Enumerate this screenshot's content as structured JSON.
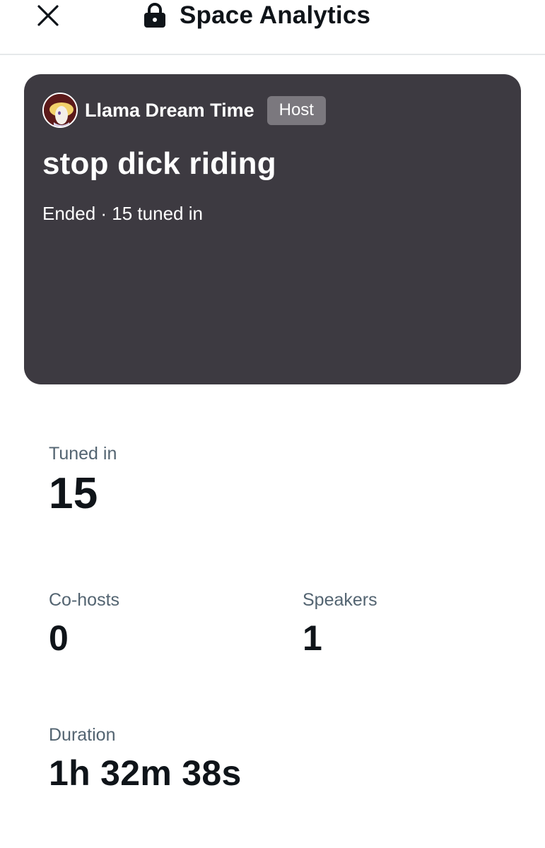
{
  "header": {
    "title": "Space Analytics",
    "close_icon": "close-icon",
    "lock_icon": "lock-icon"
  },
  "space": {
    "host_name": "Llama Dream Time",
    "host_badge": "Host",
    "title": "stop dick riding",
    "status": "Ended · 15 tuned in",
    "card_color": "#3d3a41"
  },
  "stats": {
    "tuned_in": {
      "label": "Tuned in",
      "value": "15"
    },
    "co_hosts": {
      "label": "Co-hosts",
      "value": "0"
    },
    "speakers": {
      "label": "Speakers",
      "value": "1"
    },
    "duration": {
      "label": "Duration",
      "value": "1h 32m 38s"
    }
  },
  "colors": {
    "text_primary": "#0f1419",
    "text_secondary": "#536471",
    "badge_bg": "#7b787e"
  }
}
